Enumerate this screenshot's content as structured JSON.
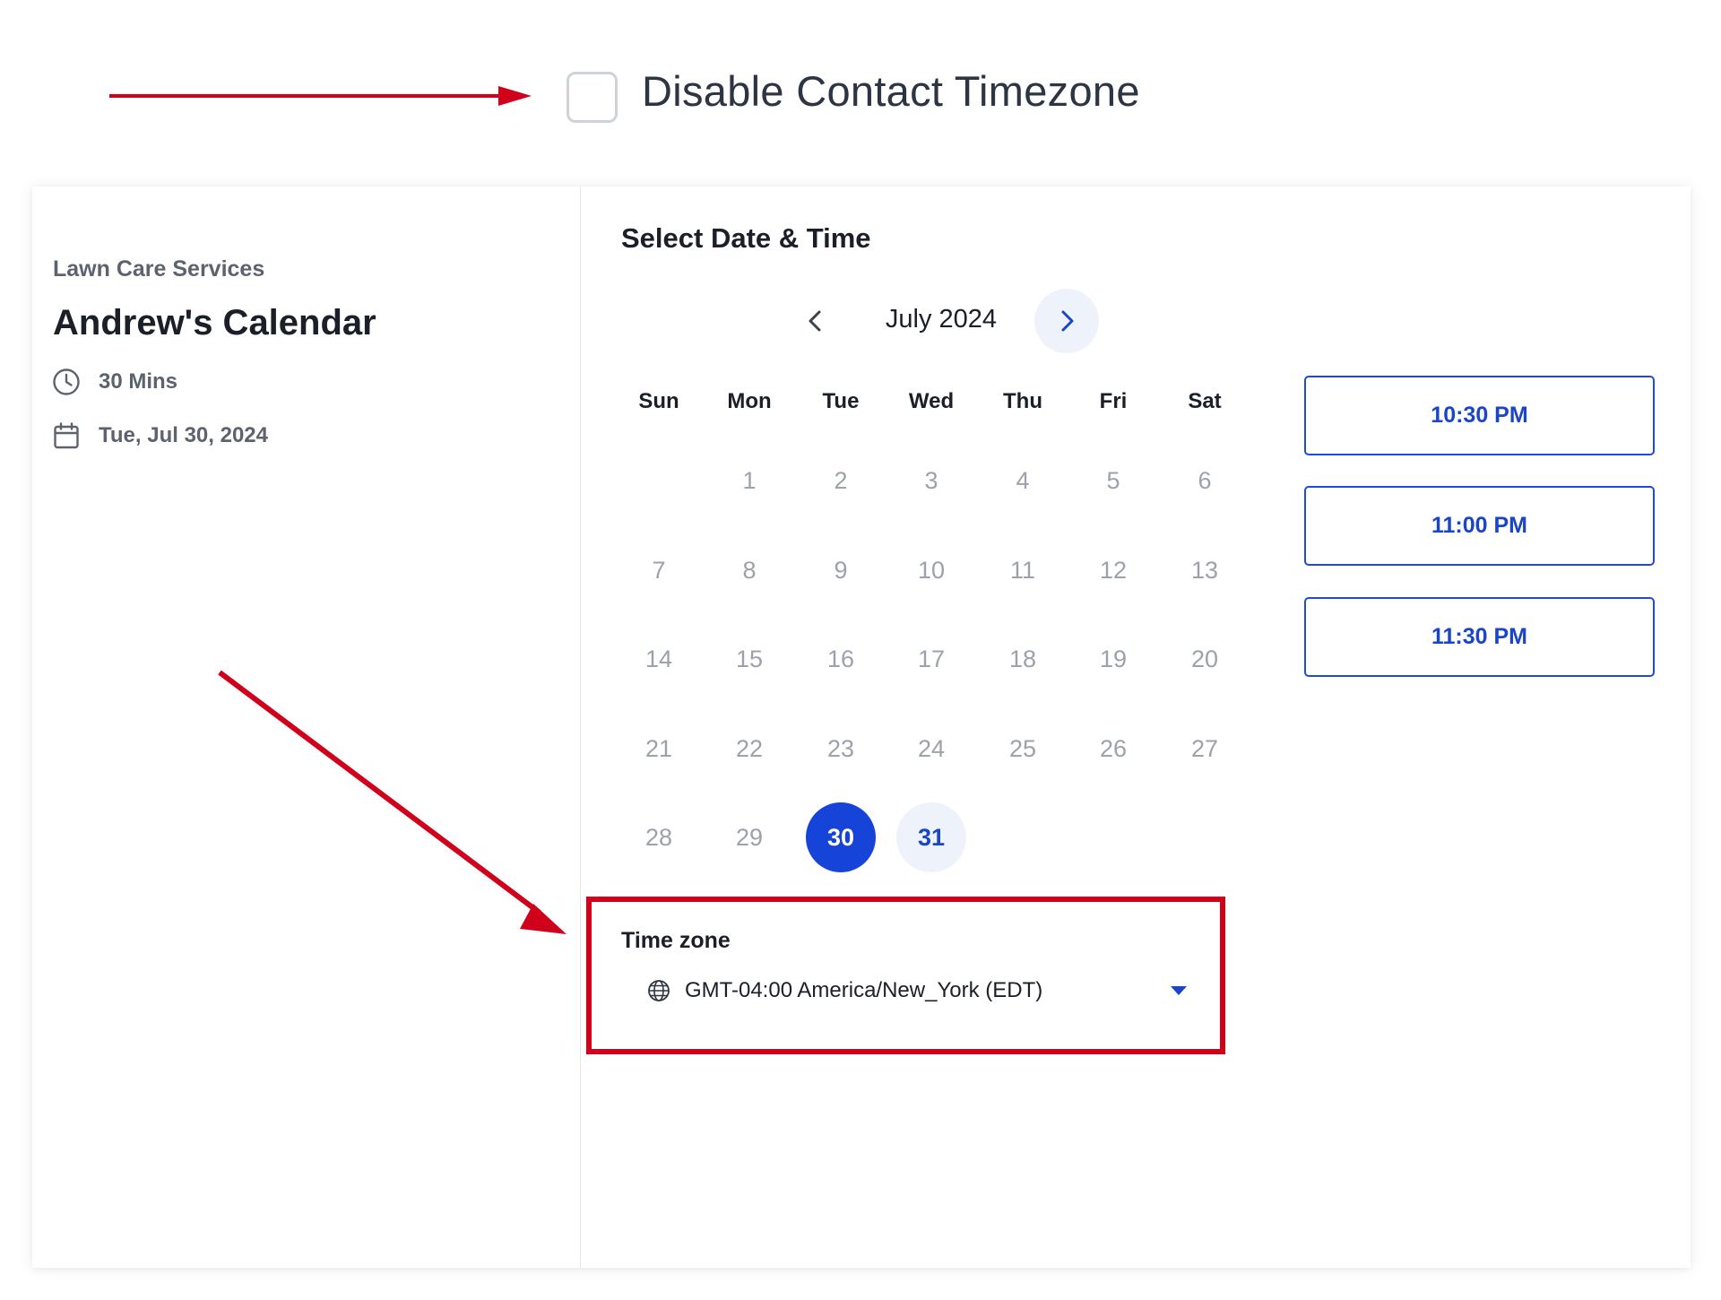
{
  "settings": {
    "disable_timezone_label": "Disable Contact Timezone",
    "disable_timezone_checked": false
  },
  "booking": {
    "company": "Lawn Care Services",
    "calendar_name": "Andrew's Calendar",
    "duration": "30 Mins",
    "selected_date": "Tue, Jul 30, 2024",
    "icons": {
      "duration": "clock-icon",
      "date": "calendar-icon"
    }
  },
  "picker": {
    "title": "Select Date & Time",
    "month_label": "July 2024",
    "weekdays": [
      "Sun",
      "Mon",
      "Tue",
      "Wed",
      "Thu",
      "Fri",
      "Sat"
    ],
    "start_offset": 1,
    "days_in_month": 31,
    "selected_day": 30,
    "available_days": [
      31
    ],
    "icons": {
      "prev": "chevron-left-icon",
      "next": "chevron-right-icon"
    }
  },
  "slots": [
    "10:30 PM",
    "11:00 PM",
    "11:30 PM"
  ],
  "timezone": {
    "label": "Time zone",
    "value": "GMT-04:00 America/New_York (EDT)",
    "icons": {
      "globe": "globe-icon",
      "caret": "caret-down-icon"
    }
  },
  "colors": {
    "accent": "#1644d8",
    "accent_text": "#1a45c8",
    "available_bg": "#edf2fb",
    "annotation": "#d0021b"
  }
}
